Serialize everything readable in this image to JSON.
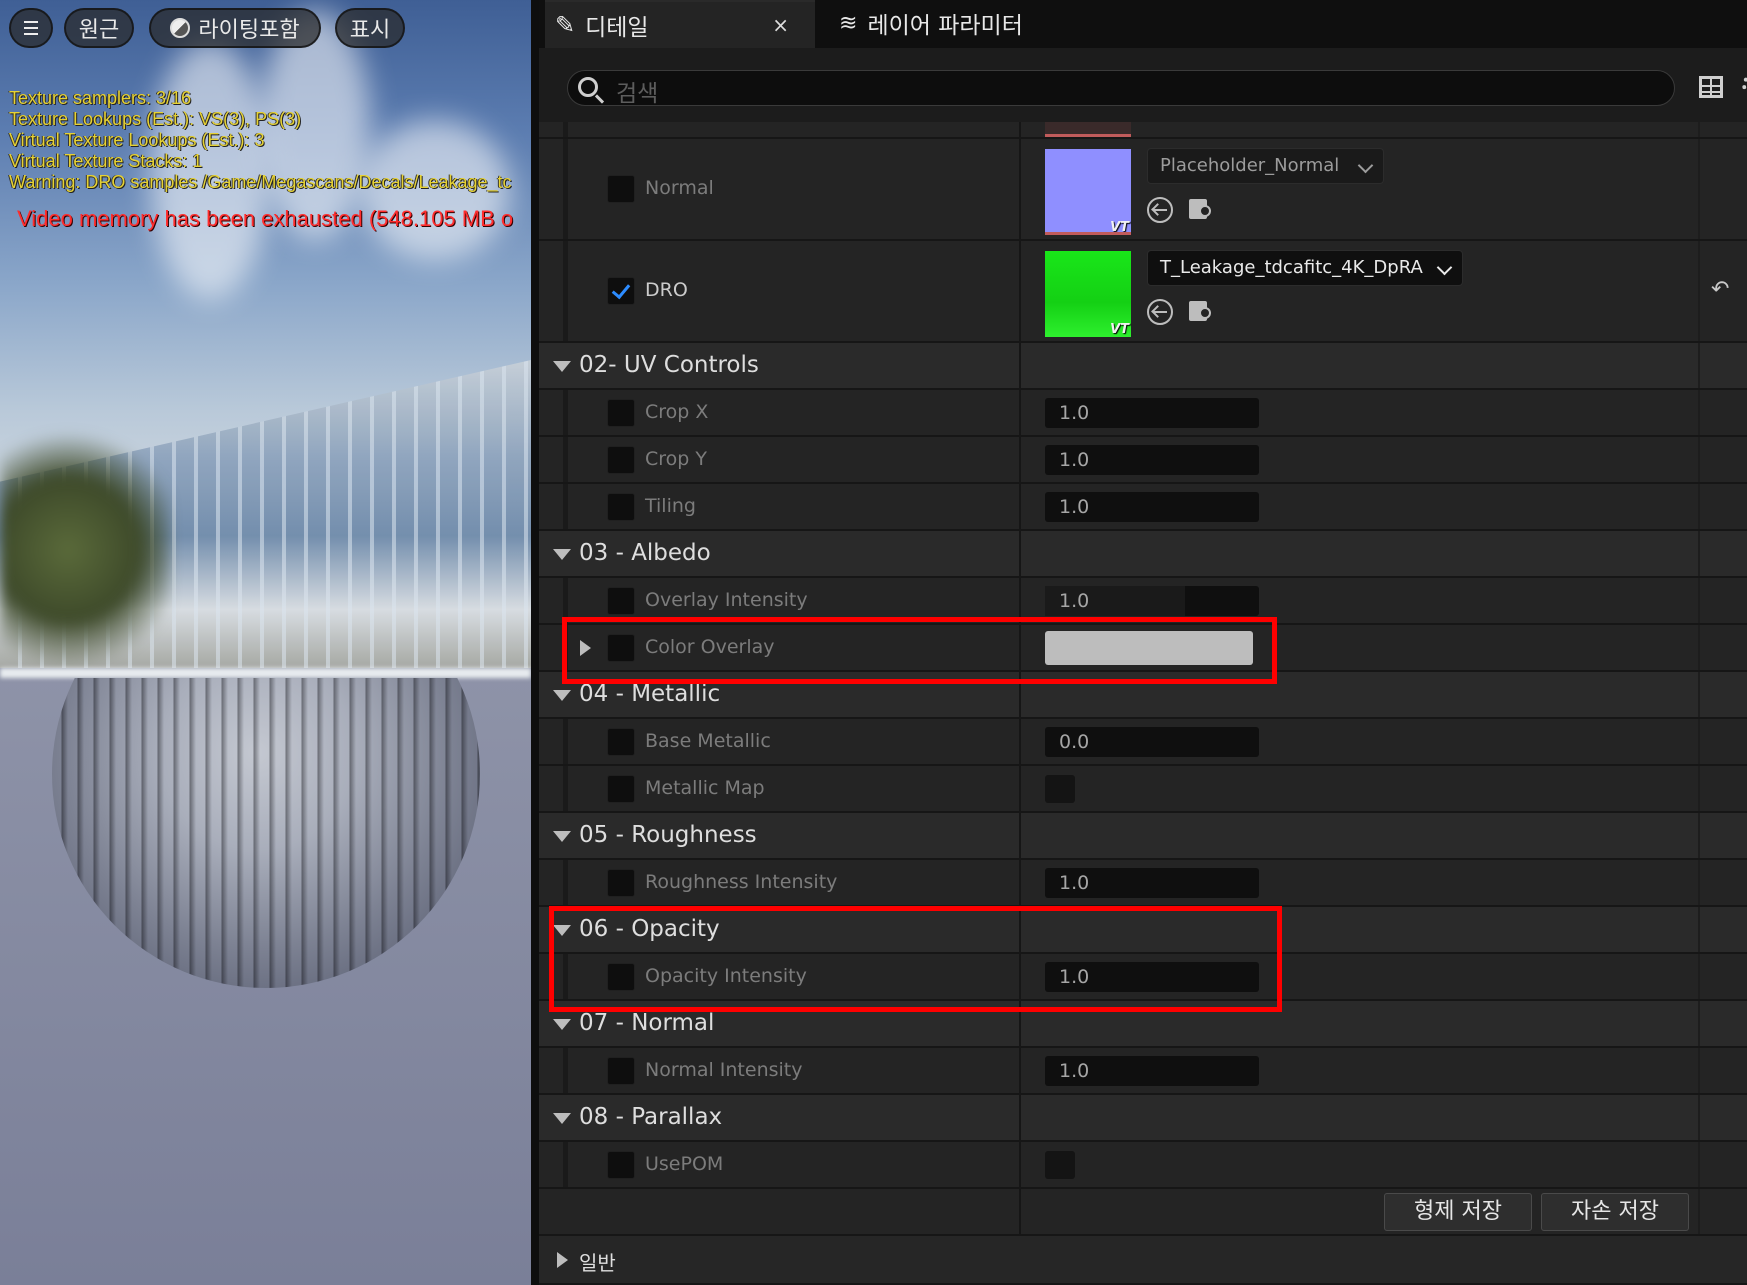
{
  "viewport": {
    "menu_label": "",
    "perspective_label": "원근",
    "lighting_label": "라이팅포함",
    "show_label": "표시",
    "stats": [
      "Texture samplers: 3/16",
      "Texture Lookups (Est.): VS(3), PS(3)",
      "Virtual Texture Lookups (Est.): 3",
      "Virtual Texture Stacks: 1",
      "Warning: DRO samples /Game/Megascans/Decals/Leakage_tc"
    ],
    "memory_warning": "Video memory has been exhausted (548.105 MB o"
  },
  "tabs": {
    "details": "디테일",
    "close": "×",
    "layer_params": "레이어 파라미터"
  },
  "search": {
    "placeholder": "검색"
  },
  "textures": {
    "normal": {
      "label": "Normal",
      "asset": "Placeholder_Normal",
      "badge": "VT",
      "swatch": "#8f8fff"
    },
    "dro": {
      "label": "DRO",
      "asset": "T_Leakage_tdcafitc_4K_DpRA",
      "badge": "VT",
      "checked": true,
      "swatch": "#19e619"
    },
    "reset_icon": "↶"
  },
  "groups": {
    "uv": {
      "title": "02- UV Controls",
      "crop_x": {
        "label": "Crop X",
        "value": "1.0"
      },
      "crop_y": {
        "label": "Crop Y",
        "value": "1.0"
      },
      "tiling": {
        "label": "Tiling",
        "value": "1.0"
      }
    },
    "albedo": {
      "title": "03 - Albedo",
      "overlay_intensity": {
        "label": "Overlay Intensity",
        "value": "1.0"
      },
      "color_overlay": {
        "label": "Color Overlay",
        "color": "#bdbdbd"
      }
    },
    "metallic": {
      "title": "04 - Metallic",
      "base_metallic": {
        "label": "Base Metallic",
        "value": "0.0"
      },
      "metallic_map": {
        "label": "Metallic Map"
      }
    },
    "roughness": {
      "title": "05 - Roughness",
      "roughness_intensity": {
        "label": "Roughness Intensity",
        "value": "1.0"
      }
    },
    "opacity": {
      "title": "06 - Opacity",
      "opacity_intensity": {
        "label": "Opacity Intensity",
        "value": "1.0"
      }
    },
    "normal": {
      "title": "07 - Normal",
      "normal_intensity": {
        "label": "Normal Intensity",
        "value": "1.0"
      }
    },
    "parallax": {
      "title": "08 - Parallax",
      "use_pom": {
        "label": "UsePOM"
      }
    }
  },
  "buttons": {
    "save_sibling": "형제 저장",
    "save_child": "자손 저장"
  },
  "general": {
    "title": "일반"
  },
  "colors": {
    "highlight": "#ff0000",
    "accent_check": "#2d8cff",
    "stats_text": "#e6d234",
    "warning_text": "#ff2d2d"
  }
}
